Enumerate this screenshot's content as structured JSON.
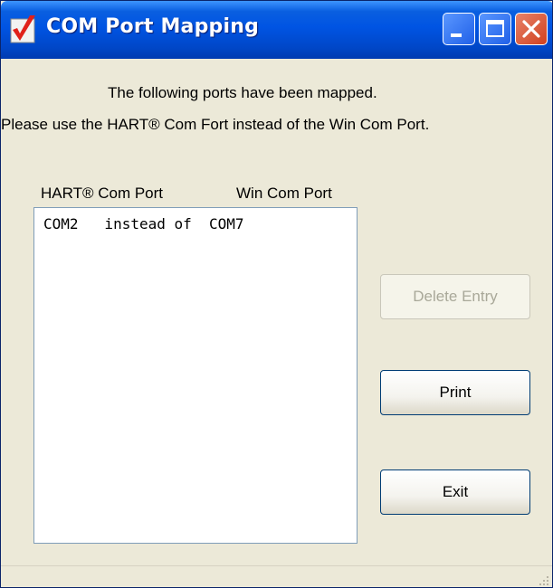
{
  "window": {
    "title": "COM Port Mapping",
    "icons": {
      "app": "checkmark-app-icon",
      "minimize": "minimize-icon",
      "maximize": "maximize-icon",
      "close": "close-icon"
    }
  },
  "message": {
    "line1": "The following ports have been mapped.",
    "line2": "Please use the HART® Com Fort instead of the Win Com Port."
  },
  "list": {
    "columns": [
      "HART® Com Port",
      "Win Com Port"
    ],
    "items": [
      "COM2   instead of  COM7"
    ]
  },
  "buttons": {
    "delete_entry": "Delete Entry",
    "print": "Print",
    "exit": "Exit"
  },
  "colors": {
    "titlebar": "#0054e3",
    "window_bg": "#ece9d8",
    "close_button": "#d0401e",
    "disabled_text": "#a9a899"
  }
}
